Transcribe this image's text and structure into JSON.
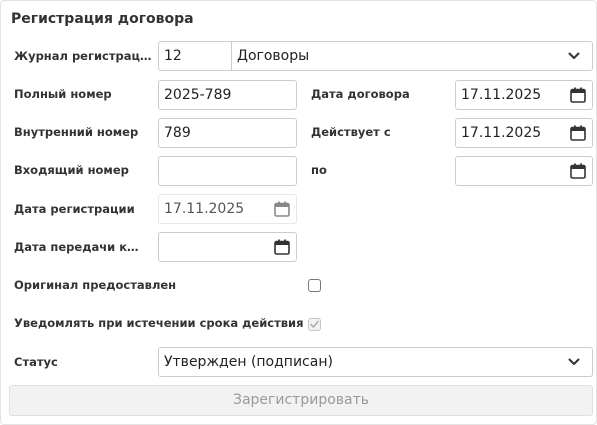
{
  "title": "Регистрация договора",
  "journal": {
    "label": "Журнал регистрации",
    "code": "12",
    "name": "Договоры"
  },
  "full_number": {
    "label": "Полный номер",
    "value": "2025-789"
  },
  "contract_date": {
    "label": "Дата договора",
    "value": "17.11.2025"
  },
  "internal_number": {
    "label": "Внутренний номер",
    "value": "789"
  },
  "valid_from": {
    "label": "Действует с",
    "value": "17.11.2025"
  },
  "incoming_number": {
    "label": "Входящий номер",
    "value": ""
  },
  "valid_to": {
    "label": "по",
    "value": ""
  },
  "registration_date": {
    "label": "Дата регистрации",
    "value": "17.11.2025"
  },
  "transfer_date": {
    "label": "Дата передачи кон...",
    "value": ""
  },
  "original_provided": {
    "label": "Оригинал предоставлен",
    "checked": false
  },
  "notify_on_expiry": {
    "label": "Уведомлять при истечении срока действия",
    "checked": true,
    "disabled": true
  },
  "status": {
    "label": "Статус",
    "value": "Утвержден (подписан)"
  },
  "register_button": {
    "label": "Зарегистрировать"
  },
  "colors": {
    "icon": "#333333",
    "border": "#cccccc",
    "disabled_text": "#9a9a9a"
  }
}
